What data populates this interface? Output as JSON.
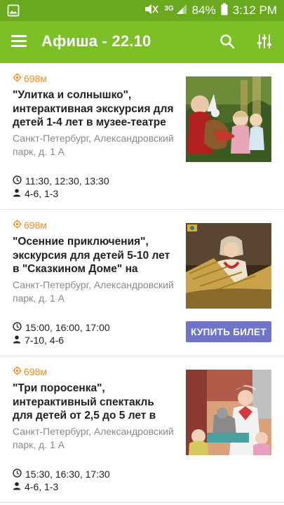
{
  "status_bar": {
    "battery": "84%",
    "time": "3:12 PM",
    "network": "3G",
    "icons": [
      "image-notification-icon",
      "mute-icon",
      "signal-icon",
      "battery-icon"
    ]
  },
  "app_bar": {
    "title": "Афиша - 22.10",
    "icons": [
      "menu-icon",
      "search-icon",
      "filter-icon"
    ],
    "color": "#7cbf26"
  },
  "events": [
    {
      "distance": "698м",
      "title": "\"Улитка и солнышко\", интерактивная экскурсия для детей 1-4 лет в музее-театре",
      "address": "Санкт-Петербург, Александровский парк, д. 1 А",
      "times": "11:30, 12:30, 13:30",
      "ages": "4-6, 1-3",
      "image": "photo of children with a puppet in a forest-themed room"
    },
    {
      "distance": "698м",
      "title": "\"Осенние приключения\", экскурсия для детей 5-10 лет в \"Сказкином Доме\" на",
      "address": "Санкт-Петербург, Александровский парк, д. 1 А",
      "times": "15:00, 16:00, 17:00",
      "ages": "7-10, 4-6",
      "buy_label": "КУПИТЬ БИЛЕТ",
      "image": "photo of woman in folk costume holding wheat sheaves"
    },
    {
      "distance": "698м",
      "title": "\"Три поросенка\", интерактивный спектакль для детей от 2,5 до 5 лет в",
      "address": "Санкт-Петербург, Александровский парк, д. 1 А",
      "times": "15:30, 16:30, 17:30",
      "ages": "4-6, 1-3",
      "image": "photo of actress in costume with children in a theatre room"
    }
  ],
  "colors": {
    "accent_distance": "#f08a1c",
    "buy_button": "#6f74c9",
    "status_bar": "#6aa820"
  }
}
